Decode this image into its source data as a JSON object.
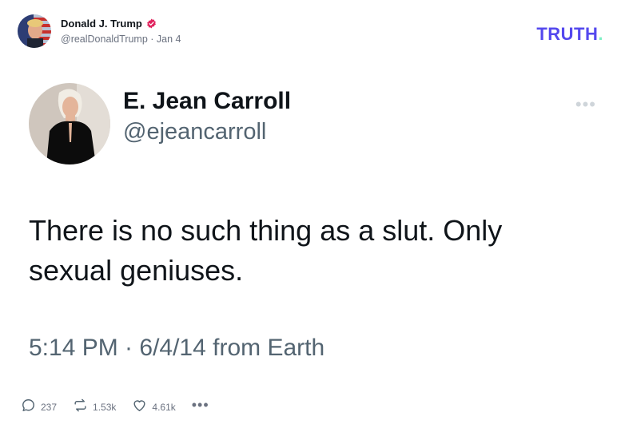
{
  "post": {
    "author_name": "Donald J. Trump",
    "author_handle": "@realDonaldTrump",
    "separator": " · ",
    "date": "Jan 4",
    "verified_color": "#e0245e"
  },
  "brand": {
    "logo_text": "TRUTH",
    "logo_dot": ".",
    "color": "#5448ee",
    "dot_color": "#7ef0c5"
  },
  "quoted_tweet": {
    "name": "E. Jean Carroll",
    "handle": "@ejeancarroll",
    "text": "There is no such thing as a slut. Only sexual geniuses.",
    "timestamp": "5:14 PM · 6/4/14 from Earth",
    "more_label": "•••"
  },
  "actions": {
    "replies": "237",
    "retruths": "1.53k",
    "likes": "4.61k",
    "more_label": "•••"
  }
}
